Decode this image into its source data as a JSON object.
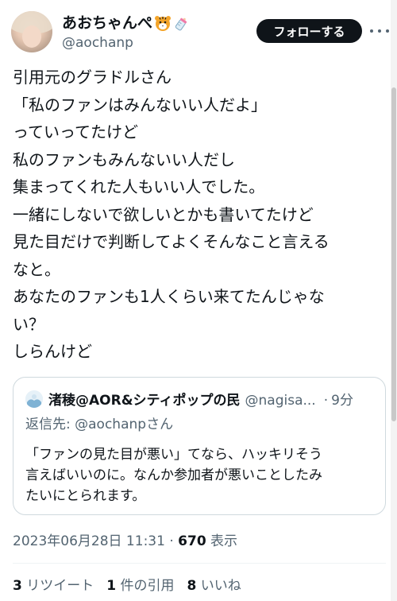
{
  "author": {
    "display_name": "あおちゃんぺ",
    "handle": "@aochanp",
    "follow_label": "フォローする"
  },
  "tweet": {
    "lines": [
      "引用元のグラドルさん",
      "「私のファンはみんないい人だよ」",
      "っていってたけど",
      "私のファンもみんないい人だし",
      "集まってくれた人もいい人でした。",
      "一緒にしないで欲しいとかも書いてたけど",
      "見た目だけで判断してよくそんなこと言える",
      "なと。",
      "あなたのファンも1人くらい来てたんじゃな",
      "い？",
      "しらんけど"
    ]
  },
  "quote": {
    "name": "渚稜@AOR&シティポップの民",
    "handle": "@nagisa...",
    "dot": "·",
    "time": "9分",
    "reply_to_prefix": "返信先: ",
    "reply_to_handle": "@aochanpさん",
    "lines": [
      "「ファンの見た目が悪い」てなら、ハッキリそう",
      "言えばいいのに。なんか参加者が悪いことしたみ",
      "たいにとられます。"
    ]
  },
  "meta": {
    "datetime": "2023年06月28日 11:31",
    "sep": " · ",
    "views_count": "670",
    "views_label": " 表示"
  },
  "stats": {
    "retweets_count": "3",
    "retweets_label": " リツイート",
    "quotes_count": "1",
    "quotes_label": " 件の引用",
    "likes_count": "8",
    "likes_label": " いいね"
  },
  "icons": {
    "emoji_1": "tiger-face-icon",
    "emoji_2": "baby-bottle-icon",
    "more": "more-icon"
  }
}
